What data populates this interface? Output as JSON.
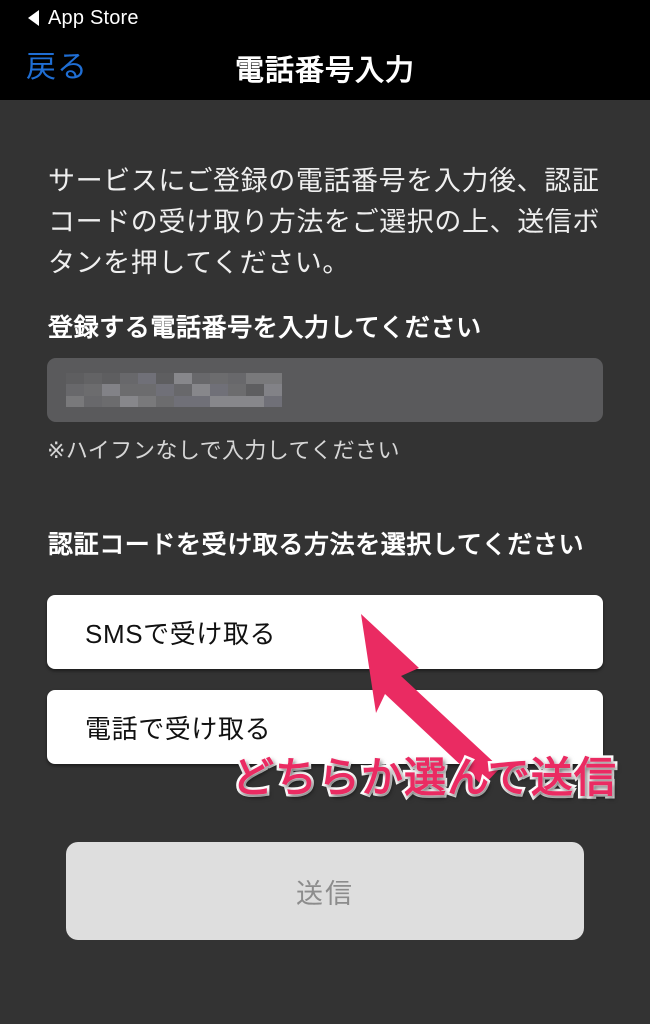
{
  "colors": {
    "page_bg": "#333333",
    "bar_bg": "#000000",
    "accent_link": "#1f6ed4",
    "field_bg": "#5a5a5c",
    "button_bg": "#ffffff",
    "submit_disabled_bg": "#dedede",
    "submit_disabled_text": "#8c8c8c",
    "annotation_pink": "#ea2b62"
  },
  "status_bar": {
    "back_icon": "triangle-left-icon",
    "back_app_label": "App Store"
  },
  "nav_bar": {
    "back_label": "戻る",
    "title": "電話番号入力"
  },
  "main": {
    "intro_text": "サービスにご登録の電話番号を入力後、認証コードの受け取り方法をご選択の上、送信ボタンを押してください。",
    "phone_section": {
      "label": "登録する電話番号を入力してください",
      "input_value": "",
      "input_placeholder": "",
      "input_redacted": "mosaic-redacted",
      "hint": "※ハイフンなしで入力してください"
    },
    "method_section": {
      "label": "認証コードを受け取る方法を選択してください",
      "options": [
        {
          "label": "SMSで受け取る",
          "name": "sms"
        },
        {
          "label": "電話で受け取る",
          "name": "call"
        }
      ]
    },
    "submit": {
      "label": "送信",
      "enabled": false
    }
  },
  "annotation": {
    "text": "どちらか選んで送信",
    "arrow_icon": "arrow-up-left-icon",
    "arrow_color": "#ea2b62"
  }
}
